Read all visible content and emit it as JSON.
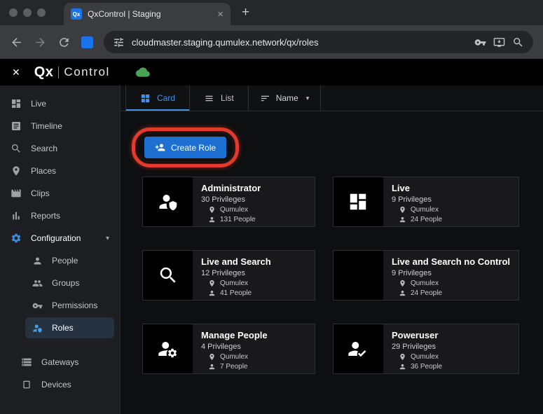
{
  "browser": {
    "tab_title": "QxControl | Staging",
    "favicon_text": "Qx",
    "url": "cloudmaster.staging.qumulex.network/qx/roles"
  },
  "glyphs": {
    "tab_close": "×",
    "new_tab": "+",
    "app_close": "✕",
    "caret": "▾",
    "chevron": "▾"
  },
  "app_header": {
    "logo_primary": "Qx",
    "logo_secondary": "Control"
  },
  "sidebar": {
    "sections": [
      {
        "level": "main",
        "items": [
          {
            "label": "Live",
            "icon": "live-grid"
          },
          {
            "label": "Timeline",
            "icon": "timeline"
          },
          {
            "label": "Search",
            "icon": "search"
          },
          {
            "label": "Places",
            "icon": "place"
          },
          {
            "label": "Clips",
            "icon": "clips"
          },
          {
            "label": "Reports",
            "icon": "reports"
          },
          {
            "label": "Configuration",
            "icon": "gear",
            "expandable": true
          }
        ]
      },
      {
        "level": "sub",
        "items": [
          {
            "label": "People",
            "icon": "person"
          },
          {
            "label": "Groups",
            "icon": "groups"
          },
          {
            "label": "Permissions",
            "icon": "key"
          },
          {
            "label": "Roles",
            "icon": "person-shield",
            "selected": true
          }
        ]
      },
      {
        "level": "sub2",
        "gap": true,
        "items": [
          {
            "label": "Gateways",
            "icon": "gateway"
          },
          {
            "label": "Devices",
            "icon": "device"
          }
        ]
      }
    ]
  },
  "toolbar": {
    "tabs": [
      {
        "label": "Card",
        "icon": "card-grid",
        "active": true
      },
      {
        "label": "List",
        "icon": "list"
      }
    ],
    "sort": {
      "label": "Name",
      "icon": "sort"
    }
  },
  "create_role": {
    "label": "Create Role",
    "icon": "person-add"
  },
  "roles": [
    {
      "name": "Administrator",
      "privileges": "30 Privileges",
      "org": "Qumulex",
      "people": "131 People",
      "icon": "person-shield"
    },
    {
      "name": "Live",
      "privileges": "9 Privileges",
      "org": "Qumulex",
      "people": "24 People",
      "icon": "live-grid"
    },
    {
      "name": "Live and Search",
      "privileges": "12 Privileges",
      "org": "Qumulex",
      "people": "41 People",
      "icon": "search"
    },
    {
      "name": "Live and Search no Control",
      "privileges": "9 Privileges",
      "org": "Qumulex",
      "people": "24 People",
      "icon": "none"
    },
    {
      "name": "Manage People",
      "privileges": "4 Privileges",
      "org": "Qumulex",
      "people": "7 People",
      "icon": "person-gear"
    },
    {
      "name": "Poweruser",
      "privileges": "29 Privileges",
      "org": "Qumulex",
      "people": "36 People",
      "icon": "person-check"
    }
  ],
  "colors": {
    "accent_blue": "#1d6fd2",
    "annotation_red": "#e23a2d",
    "cloud_green": "#4aa254"
  }
}
